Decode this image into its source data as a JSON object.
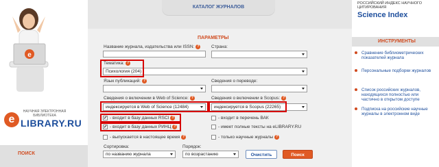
{
  "left": {
    "brand_small": "НАУЧНАЯ ЭЛЕКТРОННАЯ БИБЛИОТЕКА",
    "brand_big": "LIBRARY.RU",
    "brand_letter": "e",
    "search_label": "ПОИСК"
  },
  "header": {
    "tab_label": "КАТАЛОГ ЖУРНАЛОВ"
  },
  "right": {
    "brand_small": "РОССИЙСКИЙ ИНДЕКС НАУЧНОГО ЦИТИРОВАНИЯ",
    "brand_big": "Science Index",
    "instruments_title": "ИНСТРУМЕНТЫ",
    "links": [
      "Сравнение библиометрических показателей журнала",
      "Персональные подборки журналов",
      "Список российских журналов, находящихся полностью или частично в открытом доступе",
      "Подписка на российские научные журналы в электронном виде"
    ]
  },
  "form": {
    "params_title": "ПАРАМЕТРЫ",
    "name_label": "Название журнала, издательства или ISSN:",
    "name_value": "",
    "country_label": "Страна:",
    "country_value": "",
    "topic_label": "Тематика:",
    "topic_value": "Психология  (204)",
    "lang_label": "Язык публикаций:",
    "lang_value": "",
    "translation_label": "Сведения о переводе:",
    "translation_value": "",
    "wos_label": "Сведения о включении в Web of Science:",
    "wos_value": "индексируется в Web of Science  (12484)",
    "scopus_label": "Сведения о включении в Scopus:",
    "scopus_value": "индексируется в Scopus  (22265)",
    "chk_rsci": "- входит в базу данных RSCI",
    "chk_vak": "- входит в перечень ВАК",
    "chk_rinc": "- входит в базу данных РИНЦ",
    "chk_fulltext": "- имеет полные тексты на eLIBRARY.RU",
    "chk_current": "- выпускается в настоящее время",
    "chk_electronic": "- только научные журналы",
    "sort_label": "Сортировка:",
    "sort_value": "по названию журнала",
    "order_label": "Порядок:",
    "order_value": "по возрастанию",
    "clear_button": "Очистить",
    "search_button": "Поиск"
  }
}
